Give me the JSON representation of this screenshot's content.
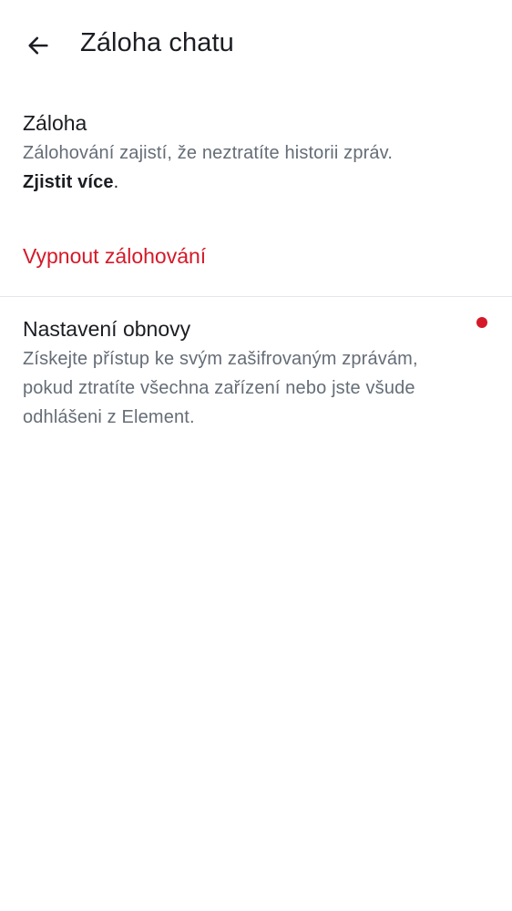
{
  "app_bar": {
    "back_icon": "arrow-left-icon",
    "title": "Záloha chatu"
  },
  "backup_section": {
    "title": "Záloha",
    "description": "Zálohování zajistí, že neztratíte historii zpráv.",
    "learn_more": "Zjistit více",
    "learn_more_suffix": "."
  },
  "disable_backup": {
    "label": "Vypnout zálohování",
    "color": "#d51928"
  },
  "recovery_section": {
    "title": "Nastavení obnovy",
    "description": "Získejte přístup ke svým zašifrovaným zprávám, pokud ztratíte všechna zařízení nebo jste všude odhlášeni z Element.",
    "indicator_color": "#d51928"
  }
}
